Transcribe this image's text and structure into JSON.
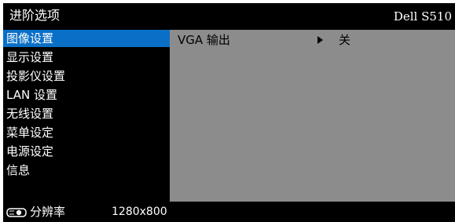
{
  "header": {
    "title": "进阶选项",
    "model": "Dell S510"
  },
  "sidebar": {
    "items": [
      {
        "label": "图像设置",
        "active": true
      },
      {
        "label": "显示设置"
      },
      {
        "label": "投影仪设置"
      },
      {
        "label": "LAN 设置"
      },
      {
        "label": "无线设置"
      },
      {
        "label": "菜单设定"
      },
      {
        "label": "电源设定"
      },
      {
        "label": "信息"
      }
    ]
  },
  "content": {
    "rows": [
      {
        "label": "VGA 输出",
        "value": "关"
      }
    ]
  },
  "status": {
    "label": "分辨率",
    "value": "1280x800",
    "icon": "projector-icon"
  },
  "colors": {
    "active": "#0a6fc7",
    "panel": "#8c8c8c",
    "background": "#000000",
    "text": "#ffffff"
  }
}
